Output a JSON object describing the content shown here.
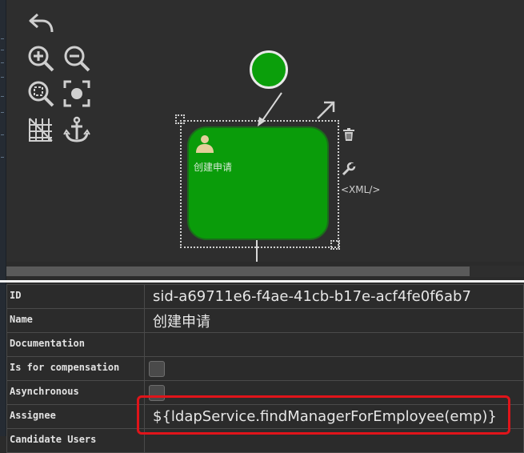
{
  "toolbar": {
    "icons": [
      "undo-icon",
      "zoom-in-icon",
      "zoom-out-icon",
      "zoom-fit-icon",
      "zoom-actual-icon",
      "grid-icon",
      "anchor-icon"
    ]
  },
  "canvas": {
    "task_label": "创建申请",
    "xml_label": "<XML/>",
    "colors": {
      "task_fill": "#0a9c0a",
      "start_fill": "#0b9f0b",
      "canvas_bg": "#2e2e2e"
    }
  },
  "properties": {
    "rows": [
      {
        "key": "ID",
        "value": "sid-a69711e6-f4ae-41cb-b17e-acf4fe0f6ab7"
      },
      {
        "key": "Name",
        "value": "创建申请"
      },
      {
        "key": "Documentation",
        "value": ""
      },
      {
        "key": "Is for compensation",
        "checked": false
      },
      {
        "key": "Asynchronous",
        "checked": false
      },
      {
        "key": "Assignee",
        "value": "${ldapService.findManagerForEmployee(emp)}"
      },
      {
        "key": "Candidate Users",
        "value": ""
      }
    ],
    "highlight_color": "#e0141a"
  }
}
